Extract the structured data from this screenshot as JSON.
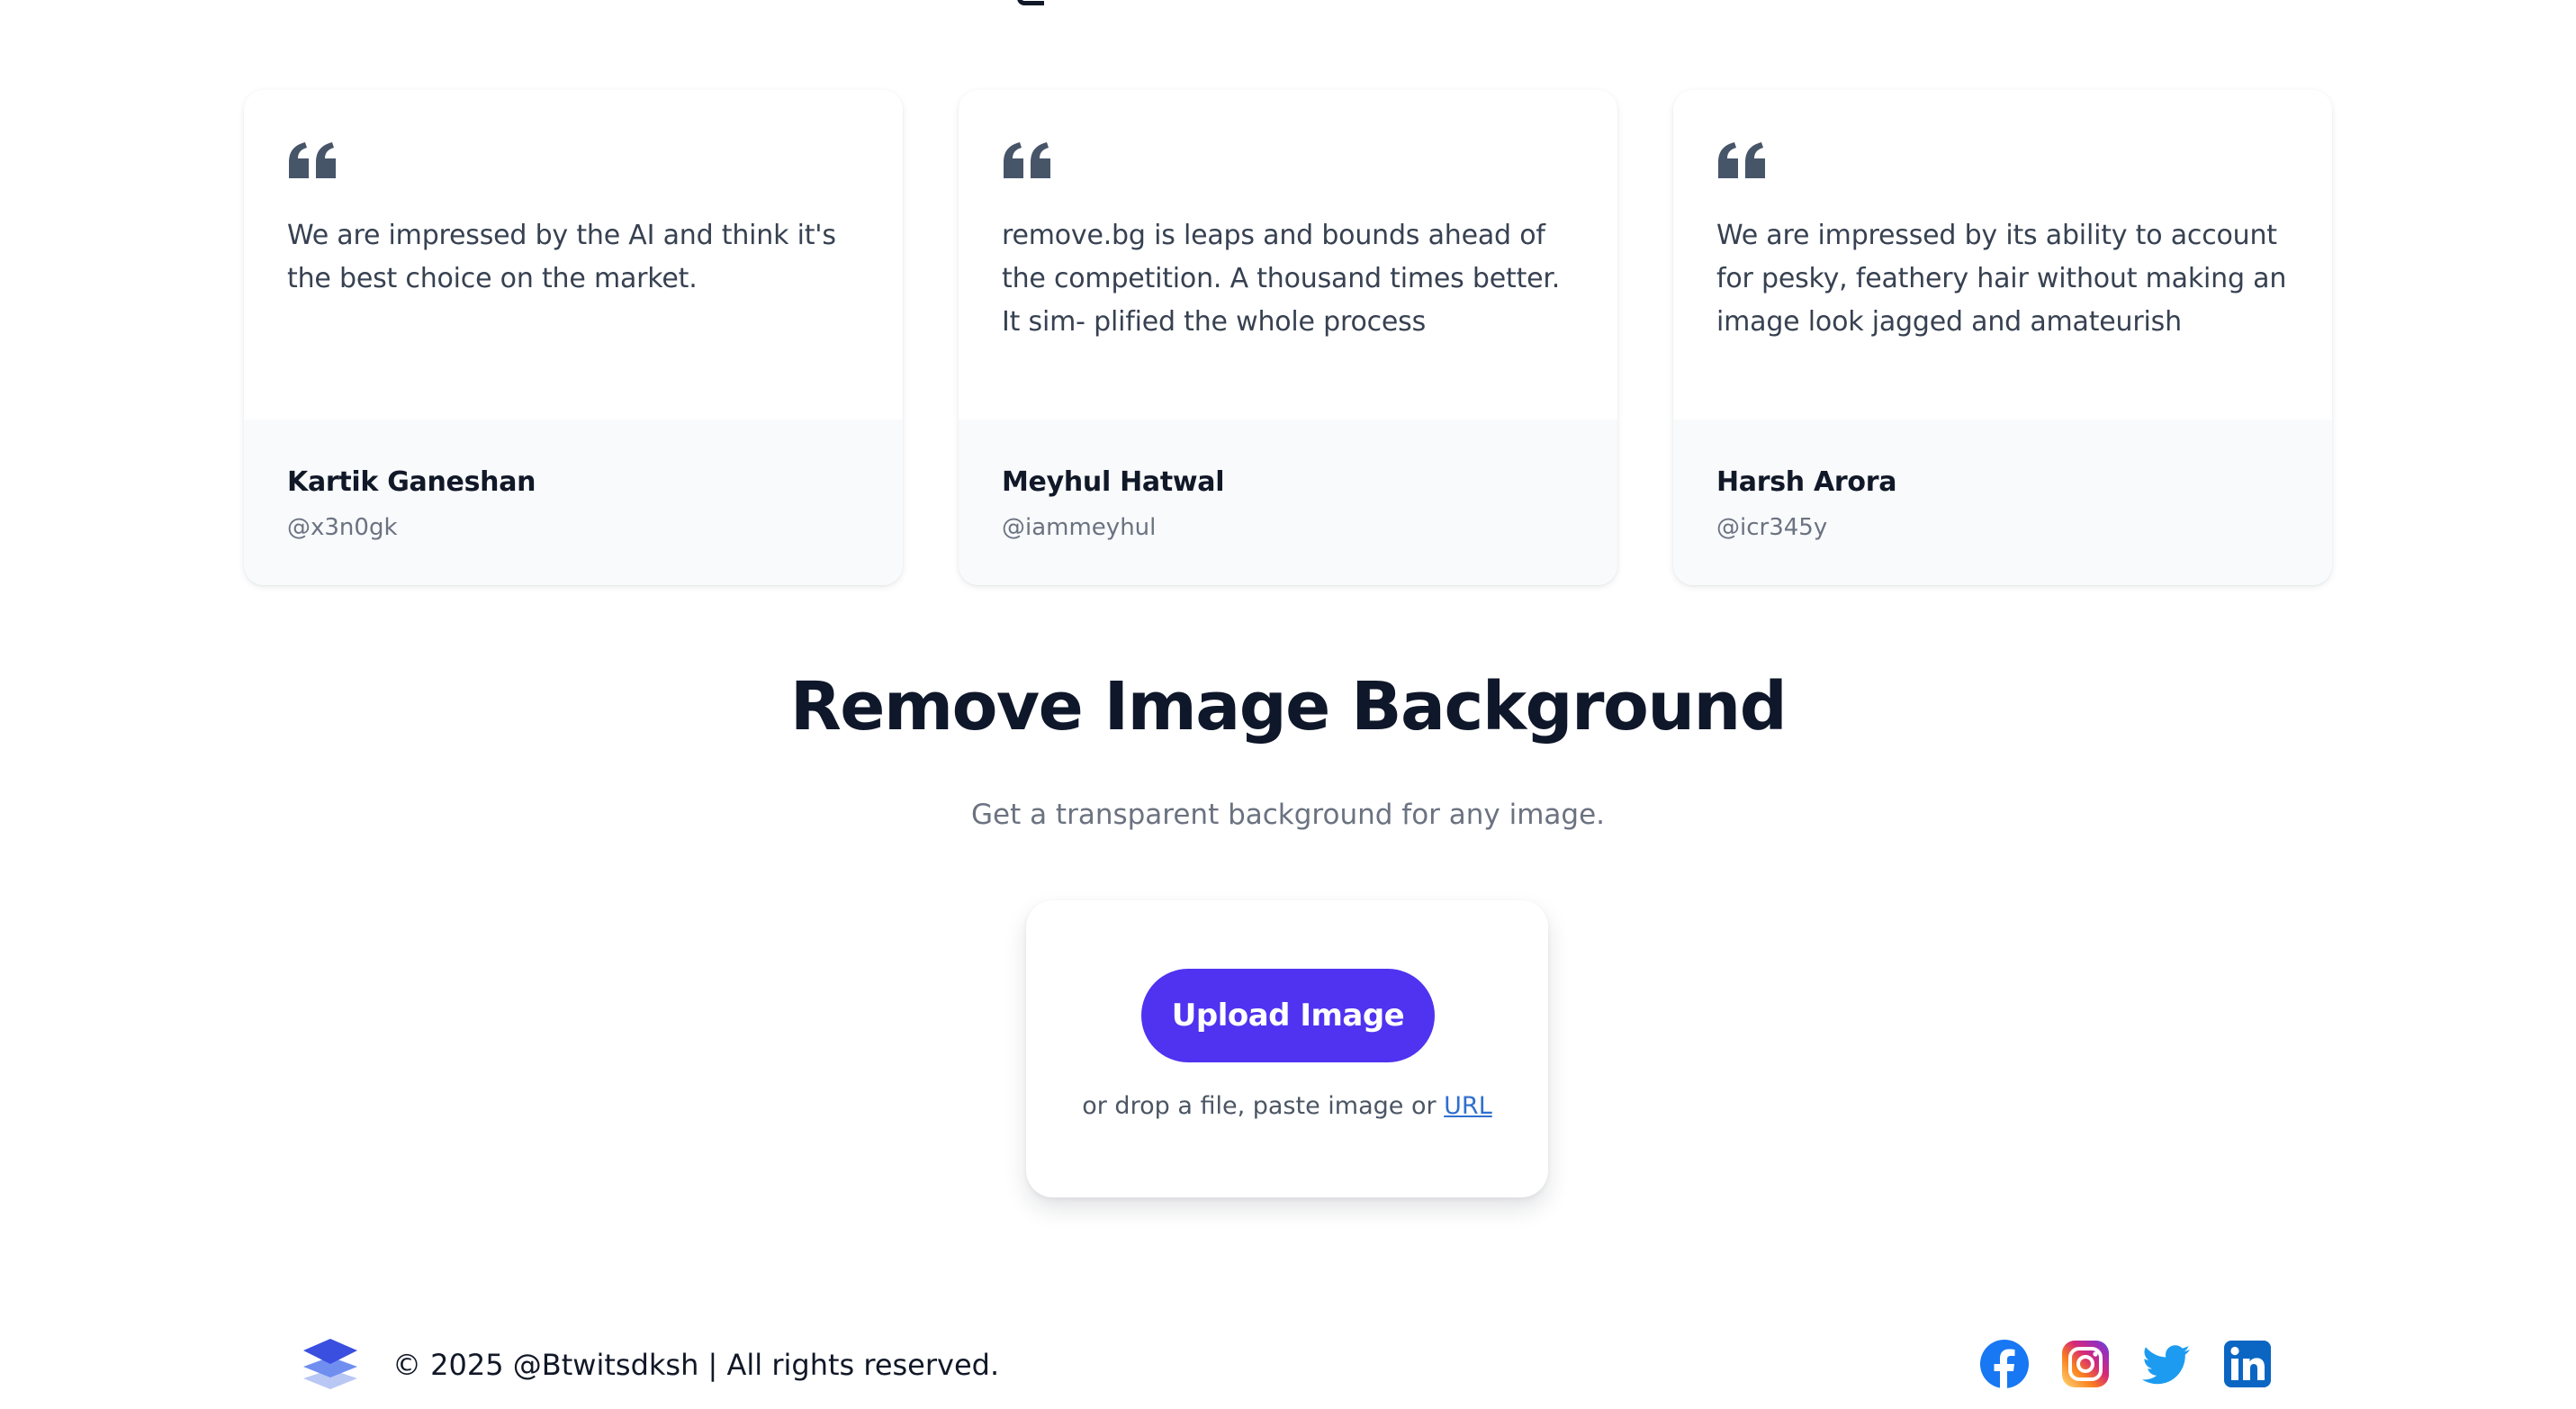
{
  "testimonials": [
    {
      "text": "We are impressed by the AI and think it's the best choice on the market.",
      "name": "Kartik Ganeshan",
      "handle": "@x3n0gk"
    },
    {
      "text": "remove.bg is leaps and bounds ahead of the competition. A thousand times better. It sim- plified the whole process",
      "name": "Meyhul Hatwal",
      "handle": "@iammeyhul"
    },
    {
      "text": "We are impressed by its ability to account for pesky, feathery hair without making an image look jagged and amateurish",
      "name": "Harsh Arora",
      "handle": "@icr345y"
    }
  ],
  "remove_bg": {
    "title": "Remove Image Background",
    "subtitle": "Get a transparent background for any image.",
    "upload_label": "Upload Image",
    "hint_text": "or drop a file, paste image or",
    "url_link": "URL"
  },
  "footer": {
    "copyright": "© 2025 @Btwitsdksh | All rights reserved.",
    "socials": [
      "facebook-icon",
      "instagram-icon",
      "twitter-icon",
      "linkedin-icon"
    ]
  },
  "colors": {
    "accent": "#4f33f0",
    "link": "#2f6fcd",
    "quote_icon": "#475569",
    "card_footer": "#f8fafc"
  }
}
